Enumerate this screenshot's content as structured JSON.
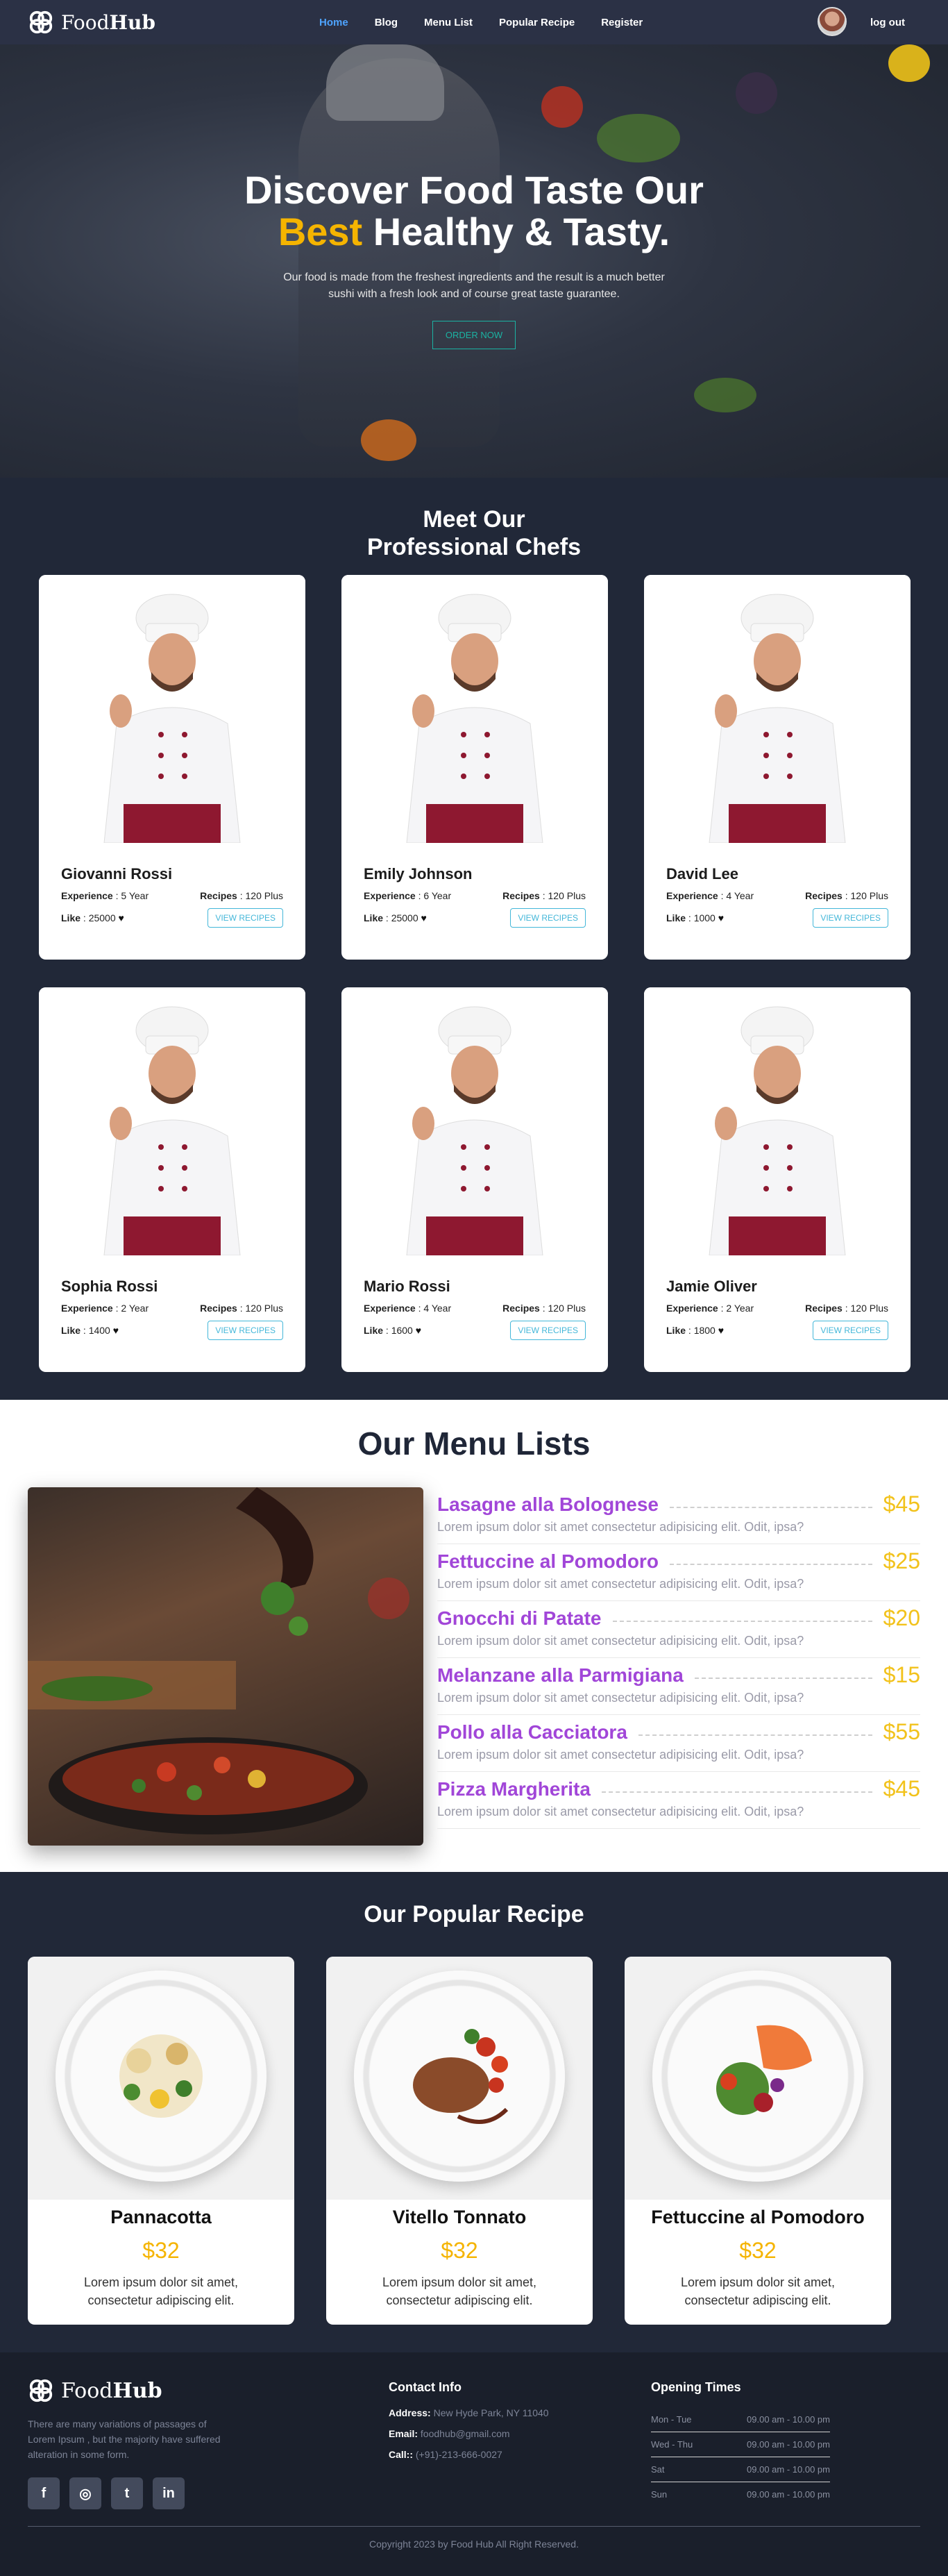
{
  "nav": {
    "brand_light": "Food",
    "brand_bold": "Hub",
    "links": [
      "Home",
      "Blog",
      "Menu List",
      "Popular Recipe",
      "Register"
    ],
    "logout": "log out"
  },
  "hero": {
    "title_line1": "Discover Food Taste Our",
    "title_gold": "Best",
    "title_rest": " Healthy & Tasty.",
    "subtitle": "Our food is made from the freshest ingredients and the result is a much better sushi with a fresh look and of course great taste guarantee.",
    "cta": "ORDER NOW"
  },
  "chefs": {
    "title_line1": "Meet Our",
    "title_line2": "Professional Chefs",
    "labels": {
      "experience": "Experience",
      "recipes": "Recipes",
      "like": "Like",
      "view": "VIEW RECIPES"
    },
    "items": [
      {
        "name": "Giovanni Rossi",
        "experience": "5 Year",
        "recipes": "120 Plus",
        "likes": "25000"
      },
      {
        "name": "Emily Johnson",
        "experience": "6 Year",
        "recipes": "120 Plus",
        "likes": "25000"
      },
      {
        "name": "David Lee",
        "experience": "4 Year",
        "recipes": "120 Plus",
        "likes": "1000"
      },
      {
        "name": "Sophia Rossi",
        "experience": "2 Year",
        "recipes": "120 Plus",
        "likes": "1400"
      },
      {
        "name": "Mario Rossi",
        "experience": "4 Year",
        "recipes": "120 Plus",
        "likes": "1600"
      },
      {
        "name": "Jamie Oliver",
        "experience": "2 Year",
        "recipes": "120 Plus",
        "likes": "1800"
      }
    ]
  },
  "menu": {
    "title": "Our Menu Lists",
    "items": [
      {
        "name": "Lasagne alla Bolognese",
        "price": "$45",
        "desc": "Lorem ipsum dolor sit amet consectetur adipisicing elit. Odit, ipsa?"
      },
      {
        "name": "Fettuccine al Pomodoro",
        "price": "$25",
        "desc": "Lorem ipsum dolor sit amet consectetur adipisicing elit. Odit, ipsa?"
      },
      {
        "name": "Gnocchi di Patate",
        "price": "$20",
        "desc": "Lorem ipsum dolor sit amet consectetur adipisicing elit. Odit, ipsa?"
      },
      {
        "name": "Melanzane alla Parmigiana",
        "price": "$15",
        "desc": "Lorem ipsum dolor sit amet consectetur adipisicing elit. Odit, ipsa?"
      },
      {
        "name": "Pollo alla Cacciatora",
        "price": "$55",
        "desc": "Lorem ipsum dolor sit amet consectetur adipisicing elit. Odit, ipsa?"
      },
      {
        "name": "Pizza Margherita",
        "price": "$45",
        "desc": "Lorem ipsum dolor sit amet consectetur adipisicing elit. Odit, ipsa?"
      }
    ]
  },
  "popular": {
    "title": "Our Popular Recipe",
    "items": [
      {
        "name": "Pannacotta",
        "price": "$32",
        "desc": "Lorem ipsum dolor sit amet, consectetur adipiscing elit."
      },
      {
        "name": "Vitello Tonnato",
        "price": "$32",
        "desc": "Lorem ipsum dolor sit amet, consectetur adipiscing elit."
      },
      {
        "name": "Fettuccine al Pomodoro",
        "price": "$32",
        "desc": "Lorem ipsum dolor sit amet, consectetur adipiscing elit."
      }
    ]
  },
  "footer": {
    "brand_light": "Food",
    "brand_bold": "Hub",
    "about": "There are many variations of passages of Lorem Ipsum , but the majority have suffered alteration in some form.",
    "socials": [
      "f",
      "◎",
      "t",
      "in"
    ],
    "contact": {
      "title": "Contact Info",
      "address_label": "Address:",
      "address": "New Hyde Park, NY 11040",
      "email_label": "Email:",
      "email": "foodhub@gmail.com",
      "call_label": "Call::",
      "call": "(+91)-213-666-0027"
    },
    "hours": {
      "title": "Opening Times",
      "rows": [
        {
          "day": "Mon - Tue",
          "time": "09.00 am - 10.00 pm"
        },
        {
          "day": "Wed - Thu",
          "time": "09.00 am - 10.00 pm"
        },
        {
          "day": "Sat",
          "time": "09.00 am - 10.00 pm"
        },
        {
          "day": "Sun",
          "time": "09.00 am - 10.00 pm"
        }
      ]
    },
    "copyright": "Copyright 2023 by Food Hub All Right Reserved."
  },
  "colors": {
    "accent_gold": "#f5b400",
    "menu_purple": "#a146d8",
    "nav_active": "#4ea3ff",
    "teal": "#1bb3a3"
  }
}
